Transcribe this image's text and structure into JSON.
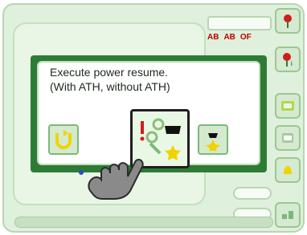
{
  "dialog": {
    "message_line1": "Execute power resume.",
    "message_line2": "(With ATH, without ATH)"
  },
  "topbar": {
    "left_text": "",
    "center_text": ""
  },
  "tags": {
    "t1": "AB",
    "t2": "AB",
    "t3": "OF"
  },
  "controls": {
    "small_pill_value": "",
    "small_pill2_value": ""
  },
  "colors": {
    "dialog_border": "#2e7b36",
    "accent_red": "#c00000",
    "accent_yellow": "#f0d400",
    "accent_green": "#2e7b36"
  },
  "icons": [
    "resume-ath-icon",
    "resume-icon",
    "restart-icon",
    "hand-pointer-icon",
    "sidebar-red-flower-icon",
    "sidebar-red-flower-i-icon",
    "sidebar-tool-icon",
    "sidebar-print-icon",
    "sidebar-hand-icon",
    "sidebar-settings-icon"
  ]
}
